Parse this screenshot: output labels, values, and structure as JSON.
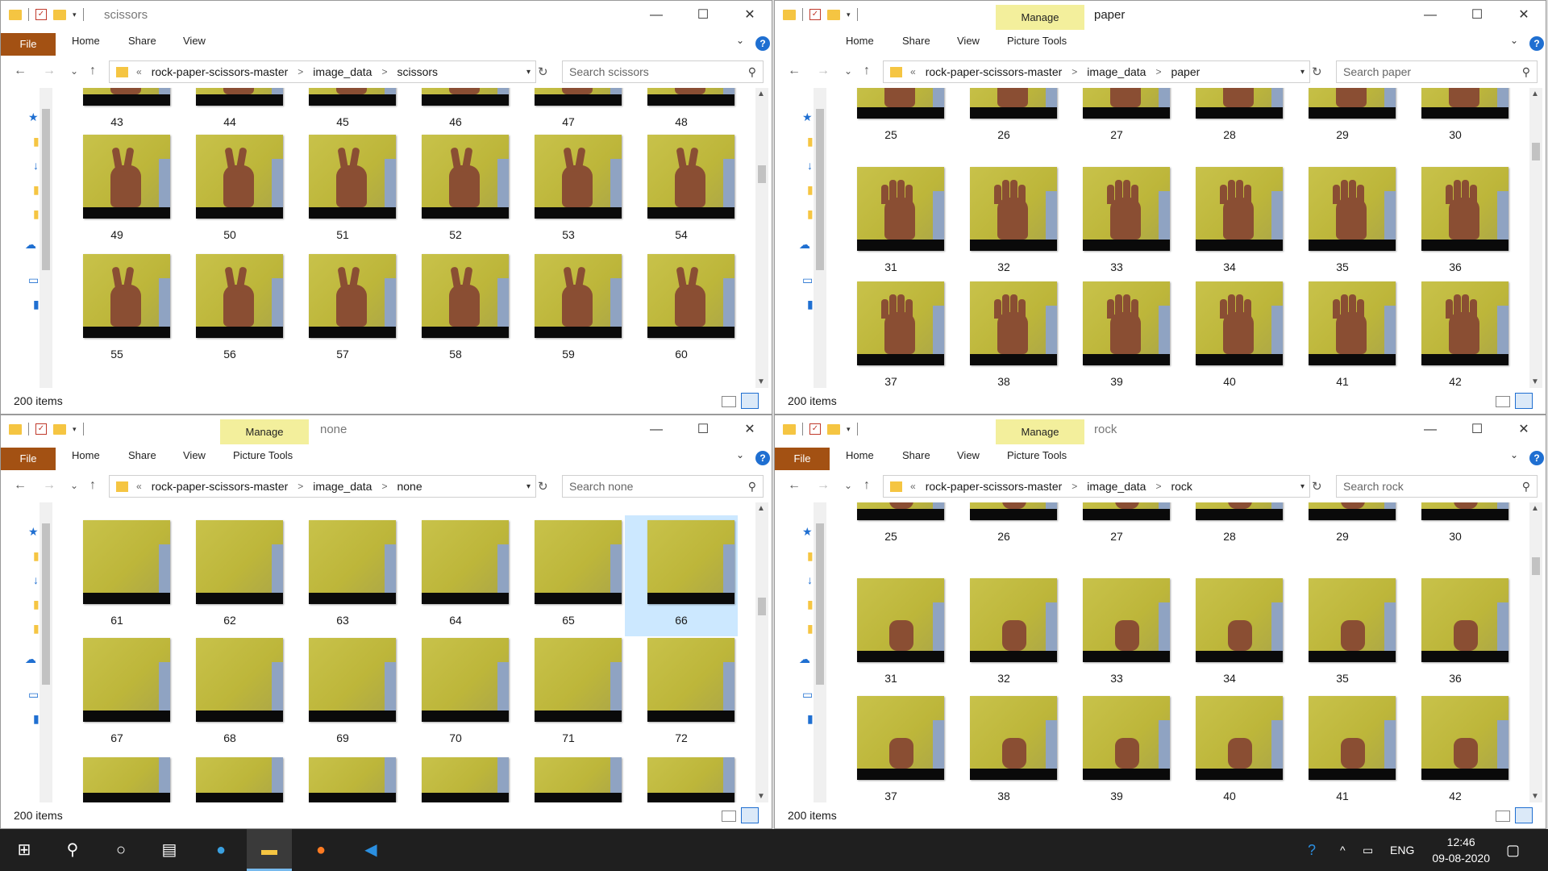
{
  "common": {
    "ribbon": {
      "file": "File",
      "home": "Home",
      "share": "Share",
      "view": "View",
      "picture_tools": "Picture Tools",
      "manage": "Manage"
    },
    "crumb_root": "rock-paper-scissors-master",
    "crumb_mid": "image_data",
    "addr_prefix": "«"
  },
  "windows": [
    {
      "title": "scissors",
      "search": "Search scissors",
      "items": "200 items",
      "labels": [
        43,
        44,
        45,
        46,
        47,
        48,
        49,
        50,
        51,
        52,
        53,
        54,
        55,
        56,
        57,
        58,
        59,
        60
      ]
    },
    {
      "title": "paper",
      "search": "Search paper",
      "items": "200 items",
      "labels": [
        25,
        26,
        27,
        28,
        29,
        30,
        31,
        32,
        33,
        34,
        35,
        36,
        37,
        38,
        39,
        40,
        41,
        42
      ]
    },
    {
      "title": "none",
      "search": "Search none",
      "items": "200 items",
      "labels": [
        61,
        62,
        63,
        64,
        65,
        66,
        67,
        68,
        69,
        70,
        71,
        72,
        "",
        "",
        "",
        "",
        "",
        ""
      ]
    },
    {
      "title": "rock",
      "search": "Search rock",
      "items": "200 items",
      "labels": [
        25,
        26,
        27,
        28,
        29,
        30,
        31,
        32,
        33,
        34,
        35,
        36,
        37,
        38,
        39,
        40,
        41,
        42
      ]
    }
  ],
  "taskbar": {
    "lang": "ENG",
    "time": "12:46",
    "date": "09-08-2020"
  },
  "icons": {
    "back": "←",
    "forward": "→",
    "up": "↑",
    "down": "⌄",
    "refresh": "↻",
    "search": "⚲",
    "minimize": "—",
    "maximize": "☐",
    "close": "✕",
    "help": "?",
    "start": "⊞",
    "cortana": "○"
  }
}
